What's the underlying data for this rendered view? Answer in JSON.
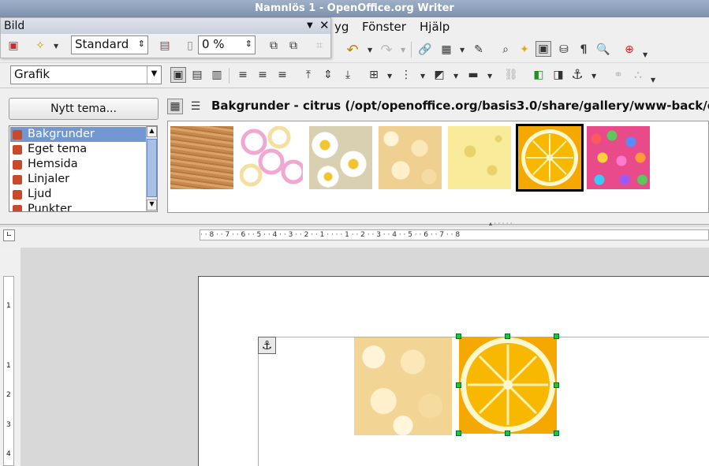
{
  "window": {
    "title": "Namnlös 1 - OpenOffice.org Writer"
  },
  "menu": {
    "items": [
      "yg",
      "Fönster",
      "Hjälp"
    ]
  },
  "bild_panel": {
    "title": "Bild",
    "mode_value": "Standard",
    "transparency_value": "0 %"
  },
  "formatting": {
    "style_value": "Grafik"
  },
  "gallery": {
    "new_theme_button": "Nytt tema...",
    "path_text": "Bakgrunder - citrus (/opt/openoffice.org/basis3.0/share/gallery/www-back/c",
    "themes": [
      "Bakgrunder",
      "Eget tema",
      "Hemsida",
      "Linjaler",
      "Ljud",
      "Punkter"
    ],
    "selected_theme": "Bakgrunder",
    "thumbnails": [
      "wood",
      "rings",
      "daisies",
      "popcorn",
      "cheese",
      "citrus",
      "candy"
    ],
    "selected_thumbnail": "citrus"
  },
  "ruler": {
    "horizontal_labels": "· · 8 · · 7 · · 6 · · 5 · · 4 · · 3 · · 2 · · 1 · ·   · · 1 · · 2 · · 3 · · 4 · · 5 · · 6 · · 7 · · 8",
    "vertical_labels": [
      "1",
      "1",
      "2",
      "3",
      "4"
    ]
  },
  "icons": {
    "anchor": "anchor-icon",
    "undo": "undo-icon",
    "pilcrow": "formatting-marks-icon"
  },
  "colors": {
    "selection": "#7397d0",
    "handle": "#16d016",
    "title_bar": "#8a9cb8"
  }
}
